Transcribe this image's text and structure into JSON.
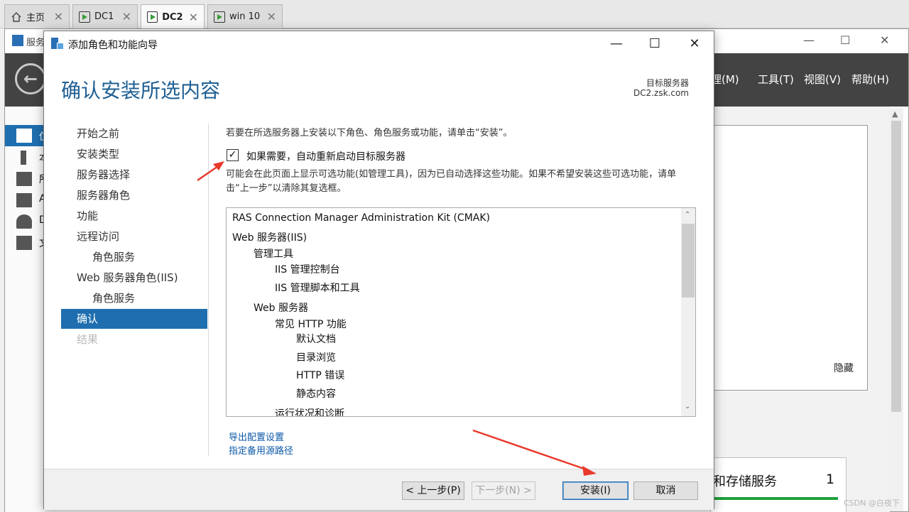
{
  "tabs": [
    {
      "label": "主页",
      "icon": "home-icon"
    },
    {
      "label": "DC1",
      "icon": "vm-icon"
    },
    {
      "label": "DC2",
      "icon": "vm-icon",
      "active": true
    },
    {
      "label": "win 10",
      "icon": "vm-icon"
    }
  ],
  "server_manager": {
    "title": "服务",
    "menu": {
      "manage": "理(M)",
      "tools": "工具(T)",
      "view": "视图(V)",
      "help": "帮助(H)"
    },
    "nav_labels": [
      "仪",
      "本",
      "所",
      "A",
      "D",
      "文"
    ],
    "hide_label": "隐藏",
    "tile": {
      "label": "和存储服务",
      "count": "1"
    },
    "watermark": "CSDN @白夜下"
  },
  "wizard": {
    "title": "添加角色和功能向导",
    "heading": "确认安装所选内容",
    "target": {
      "label": "目标服务器",
      "value": "DC2.zsk.com"
    },
    "steps": [
      {
        "label": "开始之前",
        "state": "normal",
        "level": 0
      },
      {
        "label": "安装类型",
        "state": "normal",
        "level": 0
      },
      {
        "label": "服务器选择",
        "state": "normal",
        "level": 0
      },
      {
        "label": "服务器角色",
        "state": "normal",
        "level": 0
      },
      {
        "label": "功能",
        "state": "normal",
        "level": 0
      },
      {
        "label": "远程访问",
        "state": "normal",
        "level": 0
      },
      {
        "label": "角色服务",
        "state": "normal",
        "level": 1
      },
      {
        "label": "Web 服务器角色(IIS)",
        "state": "normal",
        "level": 0
      },
      {
        "label": "角色服务",
        "state": "normal",
        "level": 1
      },
      {
        "label": "确认",
        "state": "active",
        "level": 0
      },
      {
        "label": "结果",
        "state": "disabled",
        "level": 0
      }
    ],
    "instruction": "若要在所选服务器上安装以下角色、角色服务或功能，请单击“安装”。",
    "restart_checkbox": {
      "label": "如果需要，自动重新启动目标服务器",
      "checked": true
    },
    "note": "可能会在此页面上显示可选功能(如管理工具)，因为已自动选择这些功能。如果不希望安装这些可选功能，请单击“上一步”以清除其复选框。",
    "features": [
      {
        "text": "RAS Connection Manager Administration Kit (CMAK)",
        "level": 0
      },
      {
        "text": "Web 服务器(IIS)",
        "level": 0
      },
      {
        "text": "管理工具",
        "level": 1
      },
      {
        "text": "IIS 管理控制台",
        "level": 2
      },
      {
        "text": "IIS 管理脚本和工具",
        "level": 2
      },
      {
        "text": "Web 服务器",
        "level": 1
      },
      {
        "text": "常见 HTTP 功能",
        "level": 2
      },
      {
        "text": "默认文档",
        "level": 3
      },
      {
        "text": "目录浏览",
        "level": 3
      },
      {
        "text": "HTTP 错误",
        "level": 3
      },
      {
        "text": "静态内容",
        "level": 3
      },
      {
        "text": "运行状况和诊断",
        "level": 2
      }
    ],
    "links": {
      "export": "导出配置设置",
      "alt_source": "指定备用源路径"
    },
    "buttons": {
      "prev": "< 上一步(P)",
      "next": "下一步(N) >",
      "install": "安装(I)",
      "cancel": "取消"
    },
    "annotation_color": "#e8392b"
  }
}
